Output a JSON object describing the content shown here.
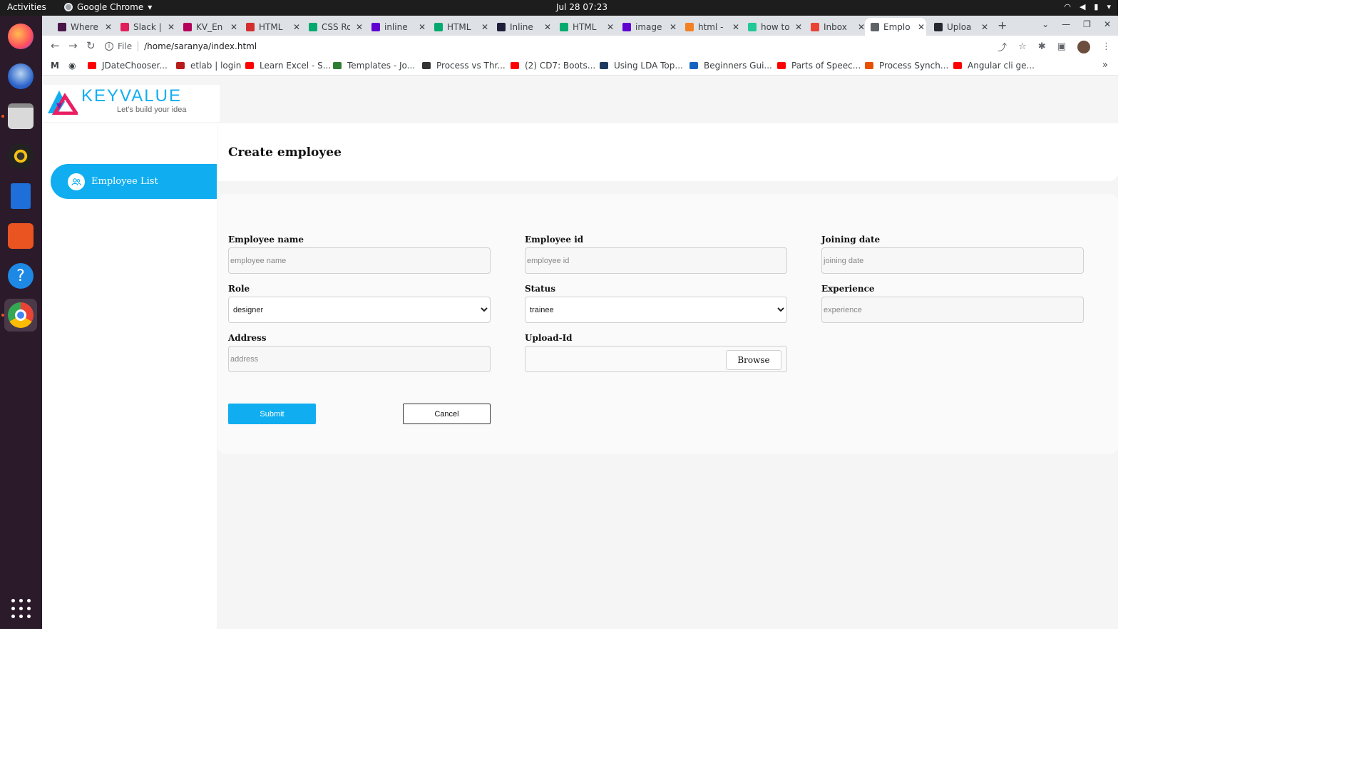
{
  "system": {
    "activities": "Activities",
    "app_name": "Google Chrome",
    "clock": "Jul 28  07:23"
  },
  "tabs": [
    {
      "title": "Where",
      "color": "#4a154b"
    },
    {
      "title": "Slack |",
      "color": "#e01e5a"
    },
    {
      "title": "KV_En",
      "color": "#b5005b"
    },
    {
      "title": "HTML",
      "color": "#d32f2f"
    },
    {
      "title": "CSS Ro",
      "color": "#04aa6d"
    },
    {
      "title": "inline",
      "color": "#6001d2"
    },
    {
      "title": "HTML",
      "color": "#04aa6d"
    },
    {
      "title": "Inline",
      "color": "#1f1f3a"
    },
    {
      "title": "HTML",
      "color": "#04aa6d"
    },
    {
      "title": "image",
      "color": "#6001d2"
    },
    {
      "title": "html -",
      "color": "#f48024"
    },
    {
      "title": "how to",
      "color": "#20c997"
    },
    {
      "title": "Inbox",
      "color": "#ea4335"
    },
    {
      "title": "Emplo",
      "color": "#5f6368"
    },
    {
      "title": "Uploa",
      "color": "#24292f"
    }
  ],
  "address_bar": {
    "scheme_label": "File",
    "url": "/home/saranya/index.html"
  },
  "bookmarks": [
    {
      "label": "JDateChooser...",
      "color": "#ff0000"
    },
    {
      "label": "etlab | login",
      "color": "#b71c1c"
    },
    {
      "label": "Learn Excel - S...",
      "color": "#ff0000"
    },
    {
      "label": "Templates - Jo...",
      "color": "#2e7d32"
    },
    {
      "label": "Process vs Thr...",
      "color": "#333333"
    },
    {
      "label": "(2) CD7: Boots...",
      "color": "#ff0000"
    },
    {
      "label": "Using LDA Top...",
      "color": "#1e3a5f"
    },
    {
      "label": "Beginners Gui...",
      "color": "#1565c0"
    },
    {
      "label": "Parts of Speec...",
      "color": "#ff0000"
    },
    {
      "label": "Process Synch...",
      "color": "#e65100"
    },
    {
      "label": "Angular cli ge...",
      "color": "#ff0000"
    }
  ],
  "brand": {
    "name": "KEYVALUE",
    "tagline": "Let's build your idea",
    "accent": "#10aef0"
  },
  "sidebar": {
    "items": [
      {
        "label": "Employee List"
      }
    ]
  },
  "page": {
    "title": "Create employee"
  },
  "form": {
    "employee_name": {
      "label": "Employee name",
      "placeholder": "employee name"
    },
    "employee_id": {
      "label": "Employee id",
      "placeholder": "employee id"
    },
    "joining_date": {
      "label": "Joining date",
      "placeholder": "joining date"
    },
    "role": {
      "label": "Role",
      "value": "designer"
    },
    "status": {
      "label": "Status",
      "value": "trainee"
    },
    "experience": {
      "label": "Experience",
      "placeholder": "experience"
    },
    "address": {
      "label": "Address",
      "placeholder": "address"
    },
    "upload": {
      "label": "Upload-Id",
      "browse": "Browse"
    },
    "submit": "Submit",
    "cancel": "Cancel"
  }
}
